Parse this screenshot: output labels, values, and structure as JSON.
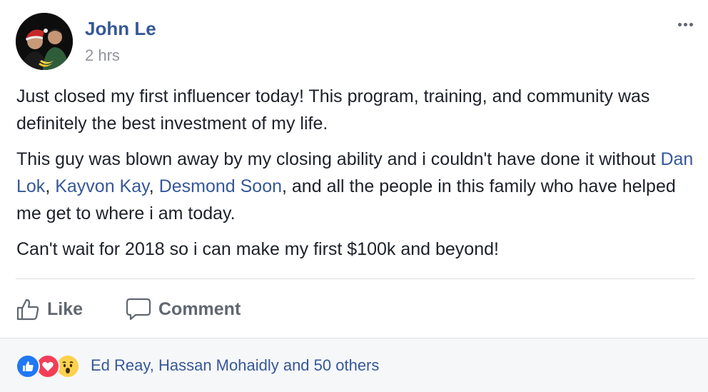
{
  "post": {
    "author": "John Le",
    "timestamp": "2 hrs",
    "paragraph1": "Just closed my first influencer today! This program, training, and community was definitely the best investment of my life.",
    "paragraph2": {
      "part1": "This guy was blown away by my closing ability and i couldn't have done it without ",
      "mention1": "Dan Lok",
      "sep1": ", ",
      "mention2": "Kayvon Kay",
      "sep2": ", ",
      "mention3": "Desmond Soon",
      "part2": ", and all the people in this family who have helped me get to where i am today."
    },
    "paragraph3": "Can't wait for 2018 so i can make my first $100k and beyond!"
  },
  "actions": {
    "like_label": "Like",
    "comment_label": "Comment"
  },
  "reactions": {
    "icons": [
      "like-reaction-icon",
      "love-reaction-icon",
      "wow-reaction-icon"
    ],
    "summary": "Ed Reay, Hassan Mohaidly and 50 others"
  },
  "colors": {
    "link": "#365899",
    "text": "#1d2129",
    "meta": "#90949c",
    "action": "#606770",
    "like": "#2078f4",
    "love": "#f33e58",
    "wow": "#fcd14d"
  }
}
